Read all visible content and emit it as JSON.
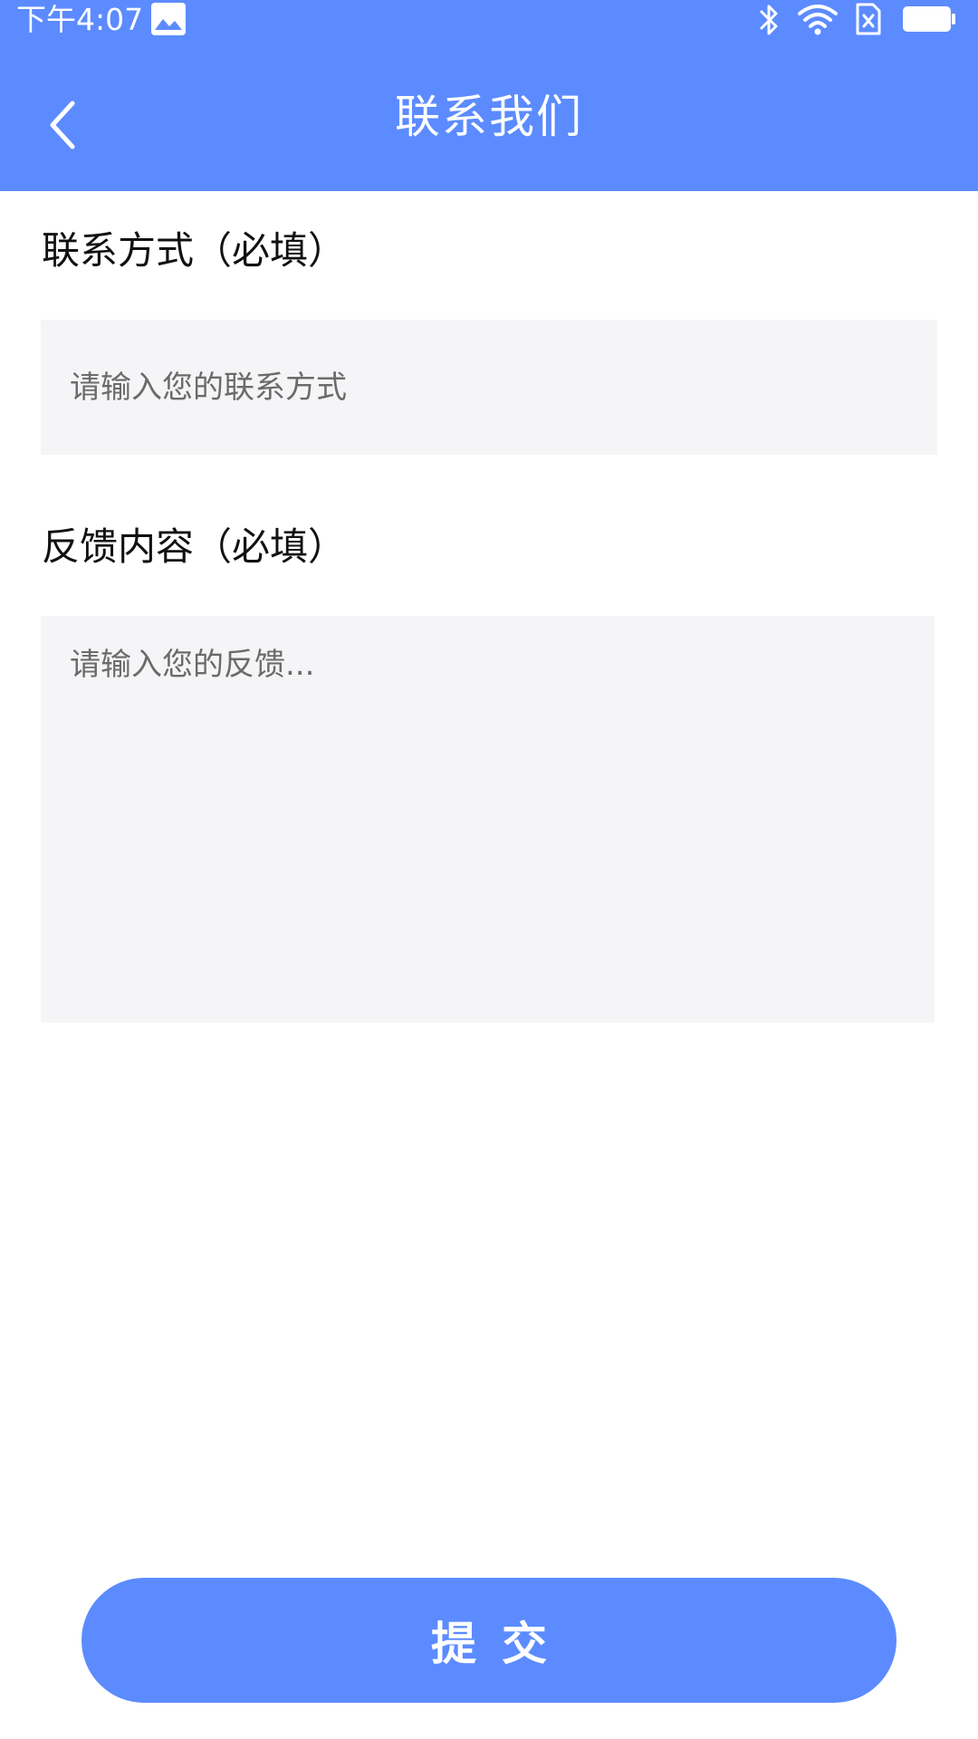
{
  "status_bar": {
    "time": "下午4:07",
    "icons": [
      "image-icon",
      "bluetooth-icon",
      "wifi-icon",
      "sim-icon",
      "battery-icon"
    ]
  },
  "nav": {
    "title": "联系我们",
    "back_icon": "chevron-left-icon"
  },
  "form": {
    "contact_label": "联系方式（必填）",
    "contact_placeholder": "请输入您的联系方式",
    "contact_value": "",
    "feedback_label": "反馈内容（必填）",
    "feedback_placeholder": "请输入您的反馈...",
    "feedback_value": ""
  },
  "submit_label": "提交",
  "colors": {
    "primary": "#5c8bff",
    "input_bg": "#f5f5f7",
    "text": "#111111",
    "placeholder": "#6b6b6b"
  }
}
